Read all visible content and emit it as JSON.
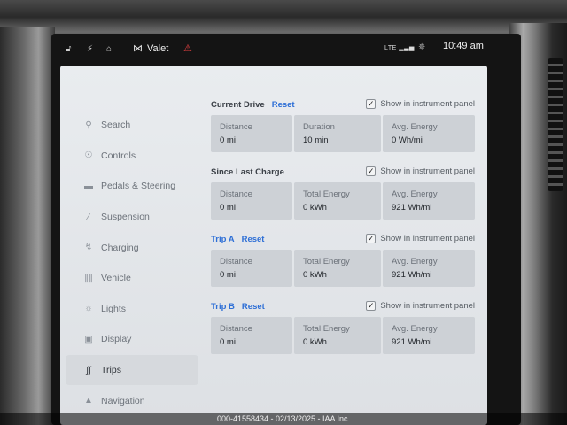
{
  "status_bar": {
    "valet_label": "Valet",
    "lte_label": "LTE",
    "time": "10:49 am"
  },
  "sidebar": {
    "items": [
      {
        "label": "Search",
        "icon": "search-icon"
      },
      {
        "label": "Controls",
        "icon": "toggle-icon"
      },
      {
        "label": "Pedals & Steering",
        "icon": "car-icon"
      },
      {
        "label": "Suspension",
        "icon": "wrench-icon"
      },
      {
        "label": "Charging",
        "icon": "bolt-icon"
      },
      {
        "label": "Vehicle",
        "icon": "sliders-icon"
      },
      {
        "label": "Lights",
        "icon": "sun-icon"
      },
      {
        "label": "Display",
        "icon": "display-icon"
      },
      {
        "label": "Trips",
        "icon": "trips-icon",
        "active": true
      },
      {
        "label": "Navigation",
        "icon": "navigation-icon"
      }
    ]
  },
  "sections": {
    "current_drive": {
      "title": "Current Drive",
      "reset": "Reset",
      "show_label": "Show in instrument panel",
      "distance_label": "Distance",
      "distance": "0 mi",
      "duration_label": "Duration",
      "duration": "10 min",
      "avg_label": "Avg. Energy",
      "avg": "0 Wh/mi"
    },
    "since_last_charge": {
      "title": "Since Last Charge",
      "show_label": "Show in instrument panel",
      "distance_label": "Distance",
      "distance": "0 mi",
      "energy_label": "Total Energy",
      "energy": "0 kWh",
      "avg_label": "Avg. Energy",
      "avg": "921 Wh/mi"
    },
    "trip_a": {
      "title": "Trip A",
      "reset": "Reset",
      "show_label": "Show in instrument panel",
      "distance_label": "Distance",
      "distance": "0 mi",
      "energy_label": "Total Energy",
      "energy": "0 kWh",
      "avg_label": "Avg. Energy",
      "avg": "921 Wh/mi"
    },
    "trip_b": {
      "title": "Trip B",
      "reset": "Reset",
      "show_label": "Show in instrument panel",
      "distance_label": "Distance",
      "distance": "0 mi",
      "energy_label": "Total Energy",
      "energy": "0 kWh",
      "avg_label": "Avg. Energy",
      "avg": "921 Wh/mi"
    }
  },
  "watermark": "000-41558434 - 02/13/2025 - IAA Inc.",
  "colors": {
    "accent_blue": "#2e6fd6",
    "panel_bg": "#e9ecef",
    "card_bg": "#cdd1d6",
    "warning_red": "#e04040"
  }
}
